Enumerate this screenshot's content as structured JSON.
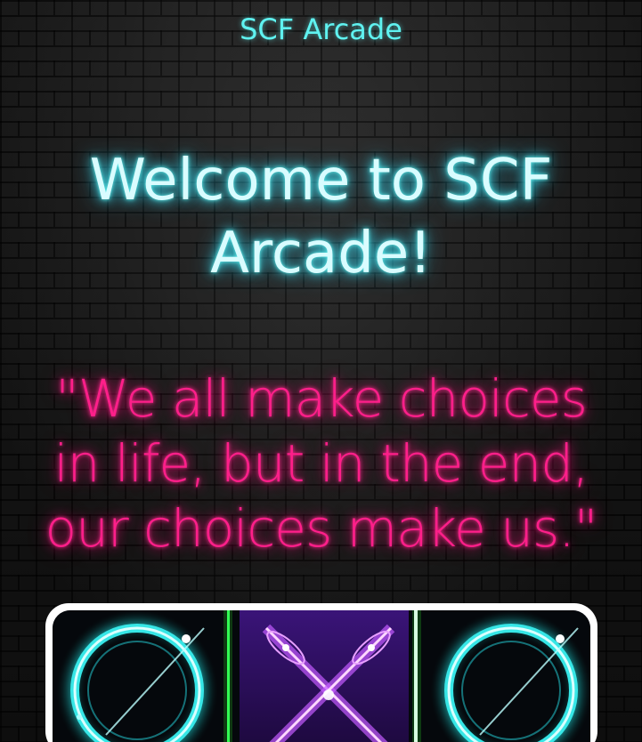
{
  "header": {
    "site_title": "SCF Arcade"
  },
  "hero": {
    "welcome_heading": "Welcome to SCF Arcade!",
    "quote": "\"We all make choices in life, but in the end, our choices make us.\""
  },
  "game_card": {
    "icons": [
      "o-ring-icon",
      "x-cross-icon",
      "o-ring-icon"
    ]
  },
  "colors": {
    "title_cyan": "#5ff2f0",
    "quote_pink": "#ff1f8a",
    "card_border": "#ffffff"
  }
}
